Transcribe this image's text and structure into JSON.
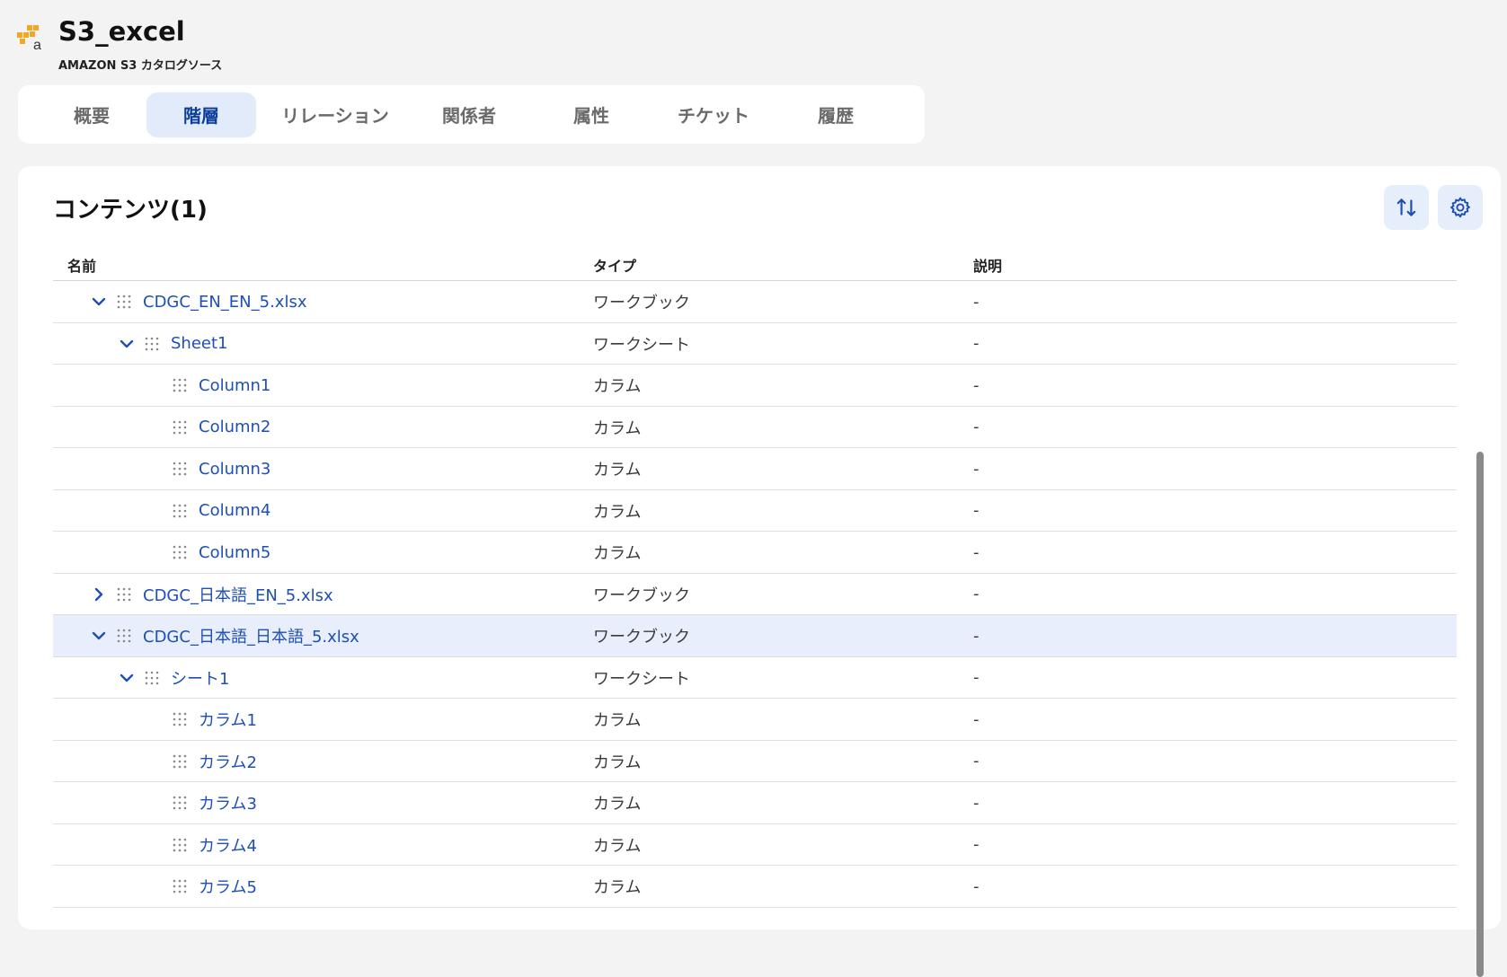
{
  "header": {
    "title": "S3_excel",
    "subtitle": "AMAZON S3 カタログソース",
    "logo_icon": "aws-logo-icon"
  },
  "tabs": [
    {
      "label": "概要",
      "active": false
    },
    {
      "label": "階層",
      "active": true
    },
    {
      "label": "リレーション",
      "active": false
    },
    {
      "label": "関係者",
      "active": false
    },
    {
      "label": "属性",
      "active": false
    },
    {
      "label": "チケット",
      "active": false
    },
    {
      "label": "履歴",
      "active": false
    }
  ],
  "content": {
    "title": "コンテンツ(1)",
    "sort_icon": "sort-icon",
    "settings_icon": "gear-icon",
    "columns": {
      "name": "名前",
      "type": "タイプ",
      "description": "説明"
    },
    "rows": [
      {
        "name": "CDGC_EN_EN_5.xlsx",
        "type": "ワークブック",
        "description": "-",
        "level": 1,
        "expander": "expanded",
        "selected": false
      },
      {
        "name": "Sheet1",
        "type": "ワークシート",
        "description": "-",
        "level": 2,
        "expander": "expanded",
        "selected": false
      },
      {
        "name": "Column1",
        "type": "カラム",
        "description": "-",
        "level": 3,
        "expander": "none",
        "selected": false
      },
      {
        "name": "Column2",
        "type": "カラム",
        "description": "-",
        "level": 3,
        "expander": "none",
        "selected": false
      },
      {
        "name": "Column3",
        "type": "カラム",
        "description": "-",
        "level": 3,
        "expander": "none",
        "selected": false
      },
      {
        "name": "Column4",
        "type": "カラム",
        "description": "-",
        "level": 3,
        "expander": "none",
        "selected": false
      },
      {
        "name": "Column5",
        "type": "カラム",
        "description": "-",
        "level": 3,
        "expander": "none",
        "selected": false
      },
      {
        "name": "CDGC_日本語_EN_5.xlsx",
        "type": "ワークブック",
        "description": "-",
        "level": 1,
        "expander": "collapsed",
        "selected": false
      },
      {
        "name": "CDGC_日本語_日本語_5.xlsx",
        "type": "ワークブック",
        "description": "-",
        "level": 1,
        "expander": "expanded",
        "selected": true
      },
      {
        "name": "シート1",
        "type": "ワークシート",
        "description": "-",
        "level": 2,
        "expander": "expanded",
        "selected": false
      },
      {
        "name": "カラム1",
        "type": "カラム",
        "description": "-",
        "level": 3,
        "expander": "none",
        "selected": false
      },
      {
        "name": "カラム2",
        "type": "カラム",
        "description": "-",
        "level": 3,
        "expander": "none",
        "selected": false
      },
      {
        "name": "カラム3",
        "type": "カラム",
        "description": "-",
        "level": 3,
        "expander": "none",
        "selected": false
      },
      {
        "name": "カラム4",
        "type": "カラム",
        "description": "-",
        "level": 3,
        "expander": "none",
        "selected": false
      },
      {
        "name": "カラム5",
        "type": "カラム",
        "description": "-",
        "level": 3,
        "expander": "none",
        "selected": false
      }
    ]
  },
  "colors": {
    "accent": "#1e4fb5",
    "tab_active_bg": "#e1ebfa",
    "selected_row_bg": "#e8eefb"
  }
}
